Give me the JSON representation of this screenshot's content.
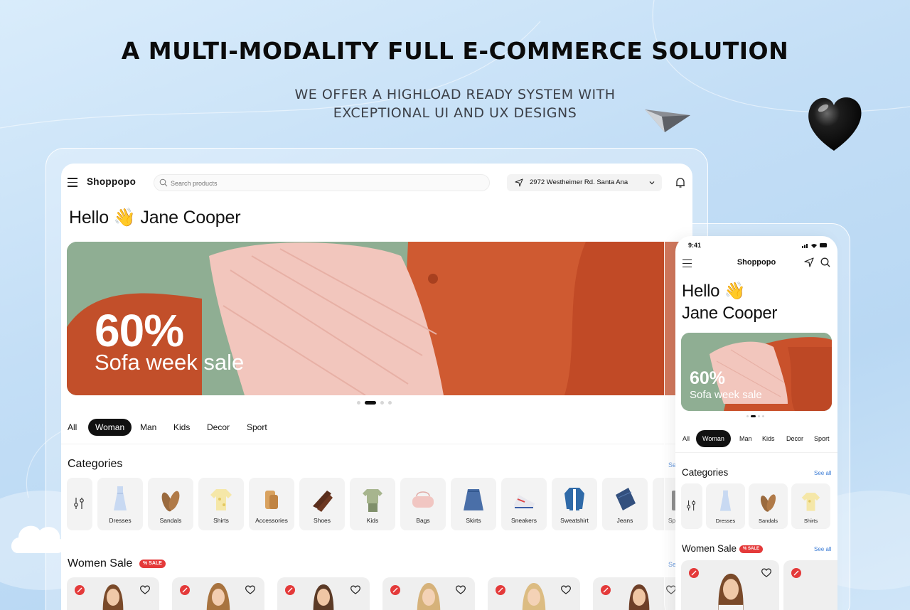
{
  "hero": {
    "title": "A MULTI-MODALITY FULL E-COMMERCE SOLUTION",
    "subtitle_line1": "WE OFFER A HIGHLOAD READY SYSTEM WITH",
    "subtitle_line2": "EXCEPTIONAL UI AND UX DESIGNS"
  },
  "tablet": {
    "logo": "Shoppopo",
    "search_placeholder": "Search products",
    "location": "2972 Westheimer Rd. Santa Ana",
    "greeting": "Hello 👋 Jane Cooper",
    "banner": {
      "percent": "60%",
      "text": "Sofa week sale"
    },
    "tabs": [
      "All",
      "Woman",
      "Man",
      "Kids",
      "Decor",
      "Sport"
    ],
    "active_tab": "Woman",
    "categories_title": "Categories",
    "see_all": "Se",
    "categories": [
      "Dresses",
      "Sandals",
      "Shirts",
      "Accessories",
      "Shoes",
      "Kids",
      "Bags",
      "Skirts",
      "Sneakers",
      "Sweatshirt",
      "Jeans",
      "Sport"
    ],
    "women_sale_title": "Women Sale",
    "sale_badge": "% SALE",
    "see_all_sale": "Se"
  },
  "phone": {
    "time": "9:41",
    "logo": "Shoppopo",
    "greeting_line1": "Hello 👋",
    "greeting_line2": "Jane Cooper",
    "banner": {
      "percent": "60%",
      "text": "Sofa week sale"
    },
    "tabs": [
      "All",
      "Woman",
      "Man",
      "Kids",
      "Decor",
      "Sport"
    ],
    "categories_title": "Categories",
    "see_all": "See all",
    "categories": [
      "Dresses",
      "Sandals",
      "Shirts"
    ],
    "women_sale_title": "Women Sale",
    "sale_badge": "% SALE",
    "see_all_sale": "See all"
  },
  "colors": {
    "accent": "#111111",
    "sale": "#e43a3a",
    "link": "#3a7bd5",
    "banner_sofa": "#c9512b",
    "banner_pillow": "#f2c6bd"
  },
  "icons": [
    "menu-icon",
    "search-icon",
    "location-arrow-icon",
    "chevron-down-icon",
    "bell-icon",
    "filter-icon",
    "heart-icon",
    "discount-tag-icon"
  ]
}
